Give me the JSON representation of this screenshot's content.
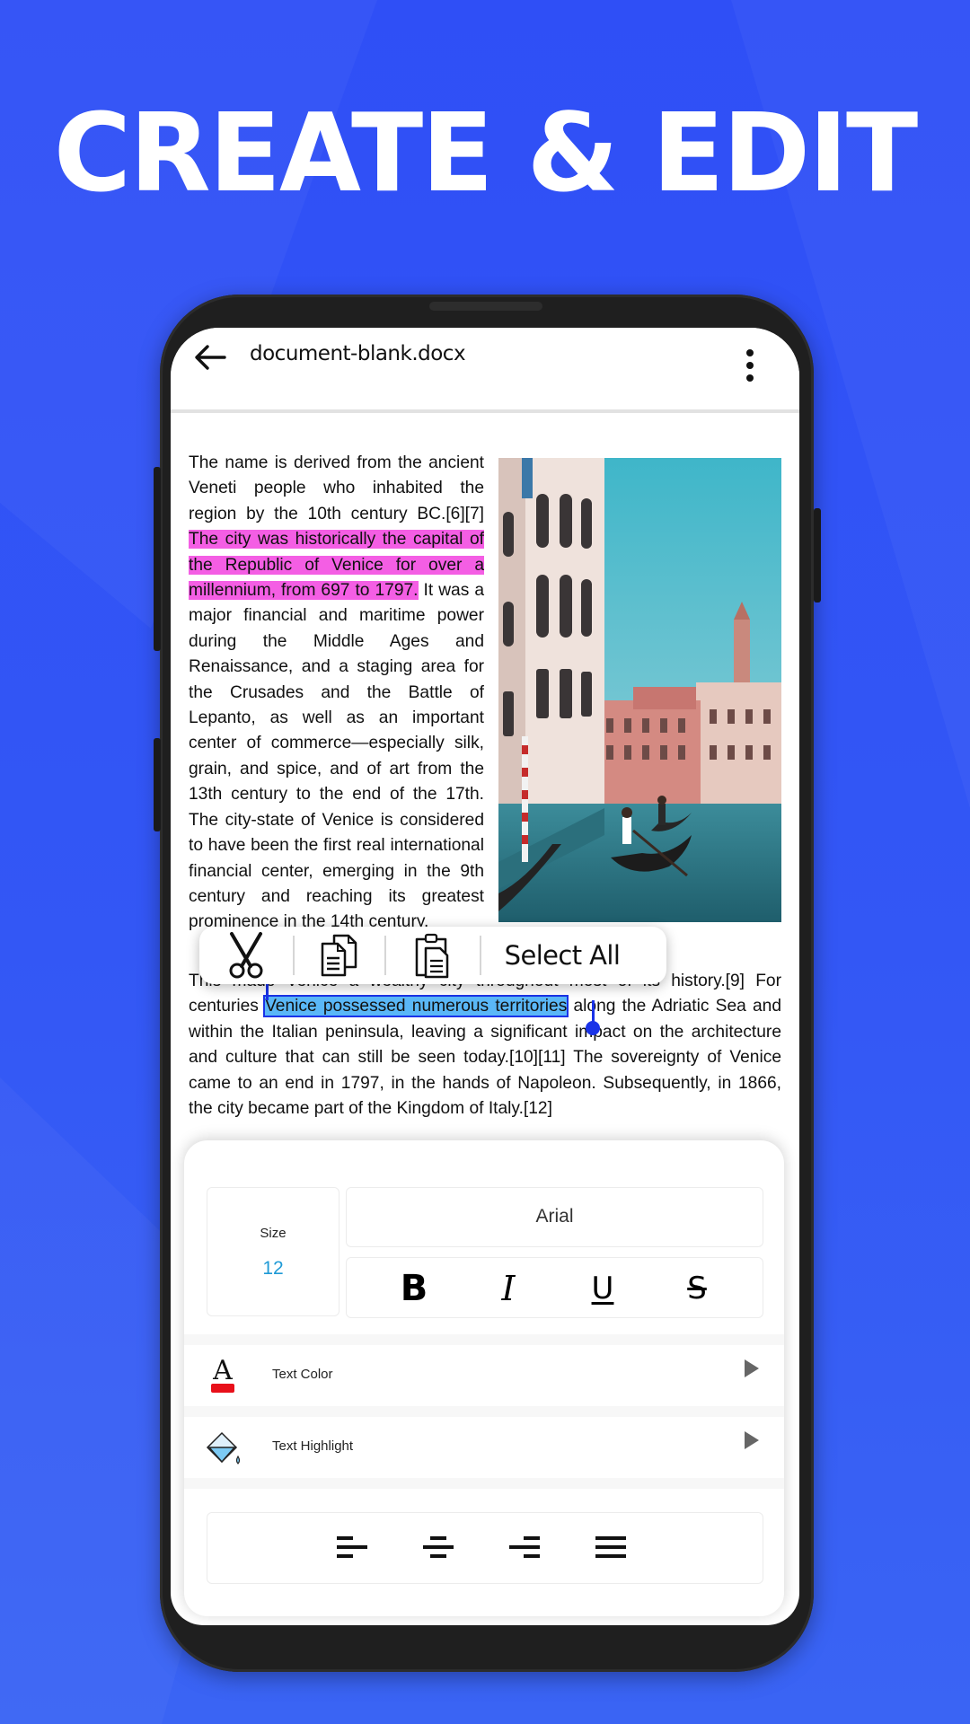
{
  "promo": {
    "headline": "CREATE & EDIT"
  },
  "colors": {
    "background": "#3357f5",
    "highlight_pink": "#f45ee4",
    "selection_blue": "#5ab7f7",
    "selection_handle": "#1a33e8",
    "size_value": "#1f9ad6",
    "text_color_swatch": "#e8101a"
  },
  "appbar": {
    "back_icon": "arrow-left-icon",
    "title": "document-blank.docx",
    "more_icon": "more-vertical-icon"
  },
  "document": {
    "column_paragraph": {
      "before_highlight": "The name is derived from the ancient Veneti people who inhabited the region by the 10th century BC.[6][7] ",
      "highlighted": "The city was historically the capital of the Republic of Venice for over a millennium, from 697 to 1797.",
      "after_highlight": " It was a major financial and maritime power during the Middle Ages and Renaissance, and a staging area for the Crusades and the Battle of Lepanto, as well as an important center of commerce—especially silk, grain, and spice, and of art from the 13th century to the end of the 17th. The city-state of Venice is considered to have been the first real international financial center, emerging in the 9th century and reaching its greatest prominence in the 14th century."
    },
    "full_paragraph": {
      "before_selection": "This made Venice a wealthy city throughout most of its history.[9] For centuries ",
      "selected": "Venice possessed numerous territories",
      "after_selection": " along the Adriatic Sea and within the Italian peninsula, leaving a significant impact on the architecture and culture that can still be seen today.[10][11] The sovereignty of Venice came to an end in 1797, in the hands of Napoleon. Subsequently, in 1866, the city became part of the Kingdom of Italy.[12]"
    },
    "image": {
      "subject": "Venice canal with gondolas and palazzi"
    }
  },
  "context_menu": {
    "items": [
      {
        "icon": "scissors-icon",
        "action": "cut"
      },
      {
        "icon": "copy-icon",
        "action": "copy"
      },
      {
        "icon": "paste-icon",
        "action": "paste"
      }
    ],
    "select_all_label": "Select All"
  },
  "format_panel": {
    "size_label": "Size",
    "size_value": "12",
    "font_name": "Arial",
    "style_buttons": [
      {
        "label": "B",
        "name": "bold"
      },
      {
        "label": "I",
        "name": "italic"
      },
      {
        "label": "U",
        "name": "underline"
      },
      {
        "label": "S",
        "name": "strikethrough"
      }
    ],
    "rows": [
      {
        "label": "Text Color",
        "icon": "text-color-icon"
      },
      {
        "label": "Text Highlight",
        "icon": "paint-bucket-icon"
      }
    ],
    "alignments": [
      "align-left",
      "align-center",
      "align-right",
      "align-justify"
    ]
  }
}
